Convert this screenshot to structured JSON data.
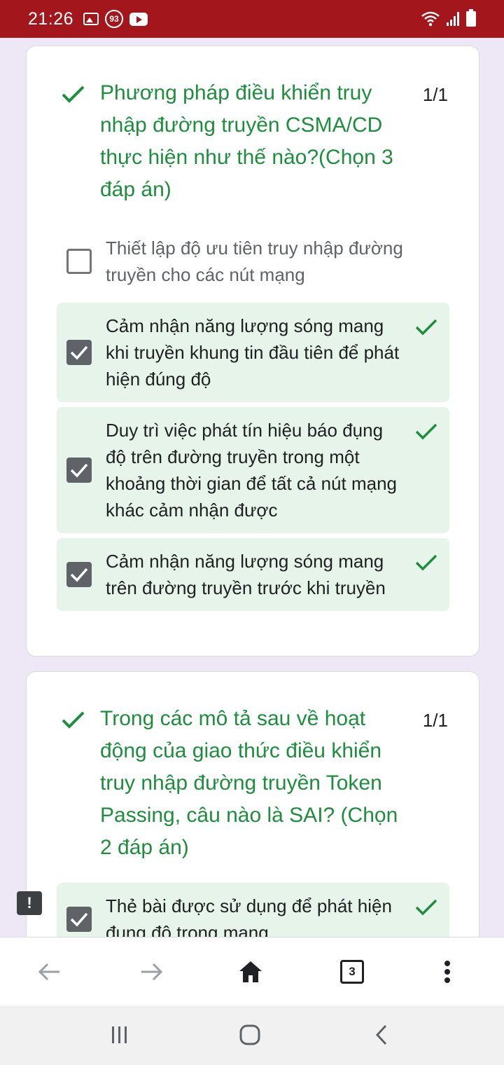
{
  "status_bar": {
    "time": "21:26",
    "badge_count": "93",
    "left_icons": [
      "gallery-icon",
      "notification-badge-icon",
      "youtube-icon"
    ],
    "right_icons": [
      "wifi-icon",
      "signal-icon",
      "battery-icon"
    ]
  },
  "question1": {
    "title": "Phương pháp điều khiển truy nhập đường truyền CSMA/CD thực hiện như thế nào?(Chọn 3 đáp án)",
    "score": "1/1",
    "options": [
      {
        "text": "Thiết lập độ ưu tiên truy nhập đường truyền cho các nút mạng",
        "checked": false,
        "correct": false
      },
      {
        "text": "Cảm nhận năng lượng sóng mang khi truyền khung tin đầu tiên để phát hiện đúng độ",
        "checked": true,
        "correct": true
      },
      {
        "text": "Duy trì việc phát tín hiệu báo đụng độ trên đường truyền trong một khoảng thời gian để tất cả nút mạng khác cảm nhận được",
        "checked": true,
        "correct": true
      },
      {
        "text": "Cảm nhận năng lượng sóng mang trên đường truyền trước khi truyền",
        "checked": true,
        "correct": true
      }
    ]
  },
  "question2": {
    "title": "Trong các mô tả sau về hoạt động của giao thức điều khiển truy nhập đường truyền Token Passing, câu nào là SAI? (Chọn 2 đáp án)",
    "score": "1/1",
    "options": [
      {
        "text": "Thẻ bài được sử dụng để phát hiện đụng độ trong mạng.",
        "checked": true,
        "correct": true
      }
    ]
  },
  "feedback_label": "!",
  "browser_bar": {
    "tabs_count": "3",
    "icons": [
      "back-arrow-icon",
      "forward-arrow-icon",
      "home-icon",
      "tabs-icon",
      "more-vert-icon"
    ]
  },
  "nav_bar": {
    "icons": [
      "recents-icon",
      "home-circle-icon",
      "back-chevron-icon"
    ]
  },
  "colors": {
    "status_bar": "#a3171c",
    "correct_green": "#1e8e3e",
    "correct_bg": "#e6f4ea",
    "page_bg": "#ede7f6"
  }
}
